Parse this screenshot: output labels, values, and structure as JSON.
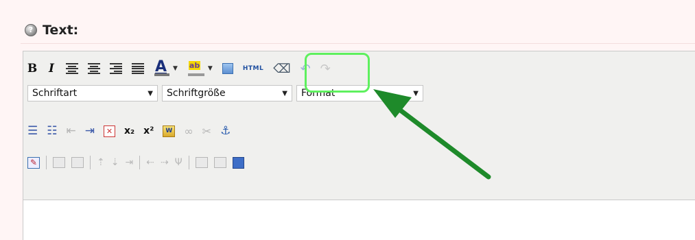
{
  "section": {
    "title": "Text:"
  },
  "toolbar": {
    "bold_label": "B",
    "italic_label": "I",
    "font_color_label": "A",
    "highlight_label": "ab",
    "html_label": "HTML",
    "font_select": "Schriftart",
    "size_select": "Schriftgröße",
    "format_select": "Format",
    "subscript_label": "x₂",
    "superscript_label": "x²"
  },
  "colors": {
    "highlight_box": "#5ef05e",
    "arrow": "#1e8a2a"
  }
}
